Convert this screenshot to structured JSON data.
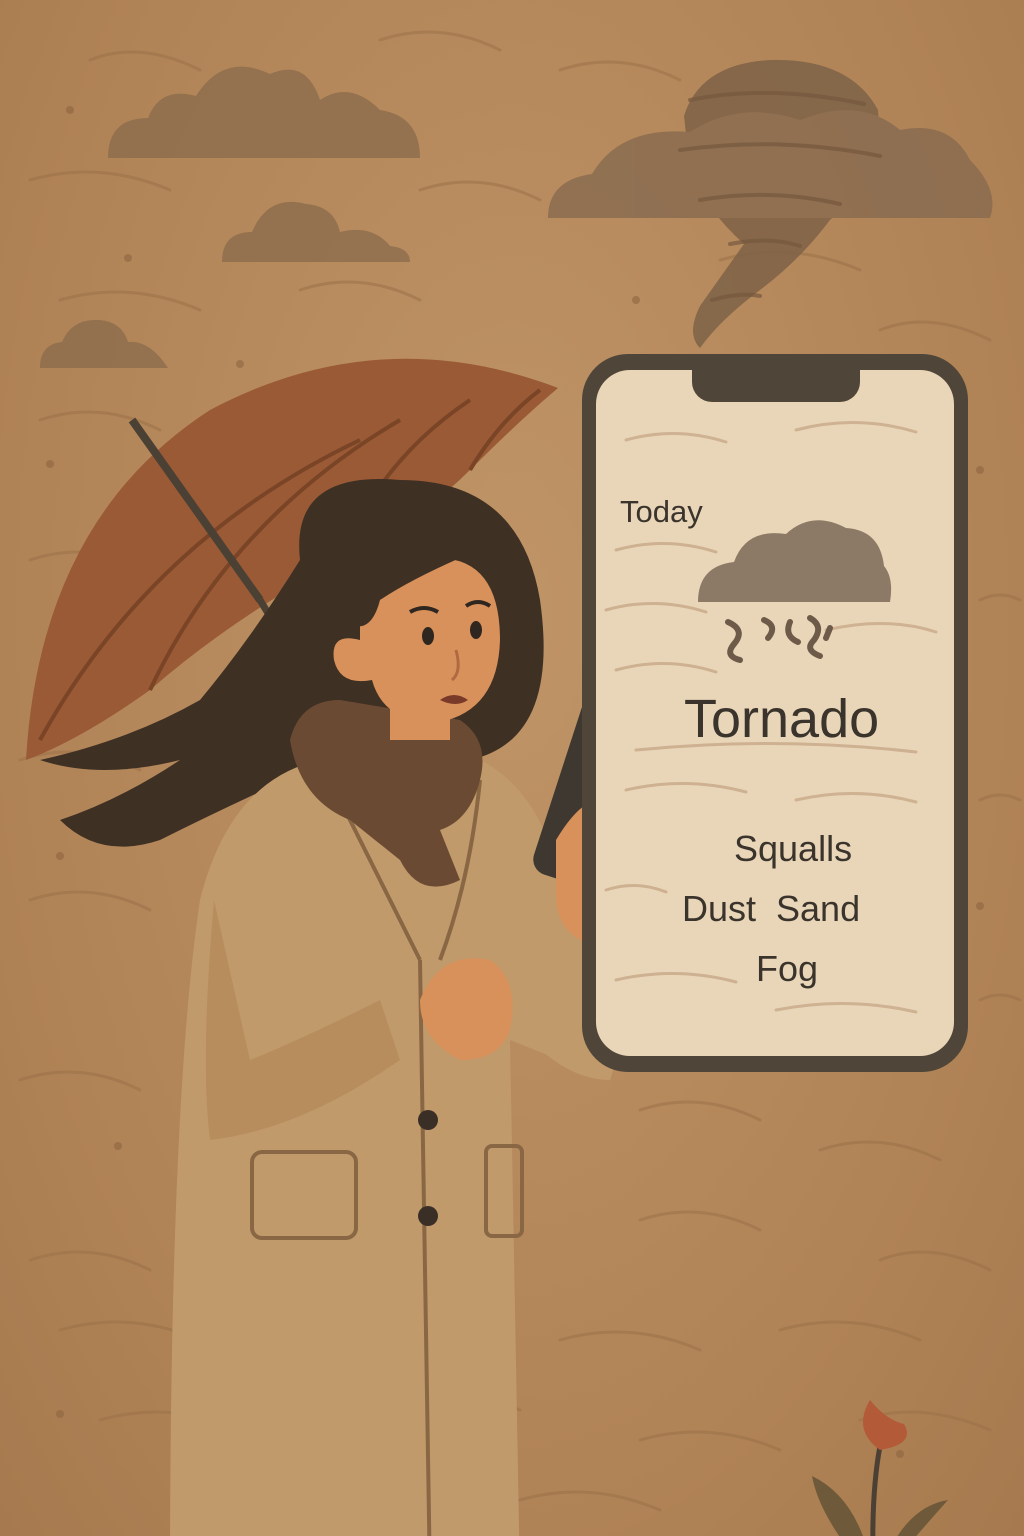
{
  "phone_screen": {
    "day_label": "Today",
    "main_condition": "Tornado",
    "conditions": [
      "Squalls",
      "Dust  Sand",
      "Fog"
    ],
    "weather_icon": "cloud-wind-icon"
  },
  "colors": {
    "background": "#b58a5c",
    "umbrella": "#9a5a35",
    "coat": "#c19a6b",
    "scarf": "#6b4a33",
    "hair": "#3f3024",
    "phone_frame": "#4f4639",
    "phone_screen": "#e9d6b8",
    "flower": "#b35a38"
  }
}
